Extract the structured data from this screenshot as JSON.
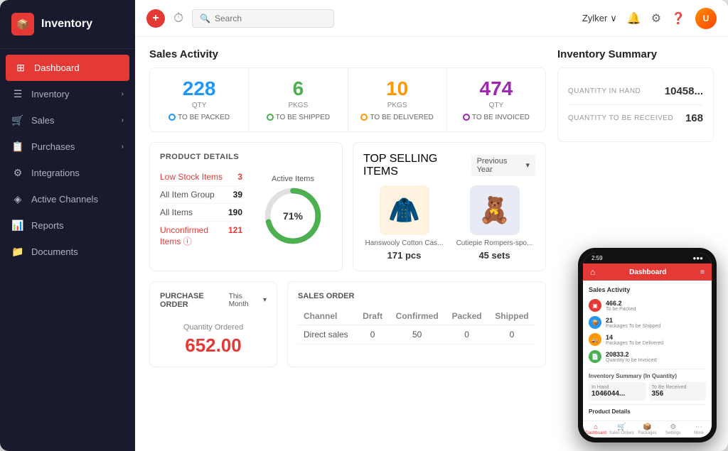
{
  "sidebar": {
    "logo": {
      "icon": "📦",
      "text": "Inventory"
    },
    "items": [
      {
        "id": "dashboard",
        "label": "Dashboard",
        "icon": "⊞",
        "active": true,
        "hasArrow": false
      },
      {
        "id": "inventory",
        "label": "Inventory",
        "icon": "☰",
        "active": false,
        "hasArrow": true
      },
      {
        "id": "sales",
        "label": "Sales",
        "icon": "🛒",
        "active": false,
        "hasArrow": true
      },
      {
        "id": "purchases",
        "label": "Purchases",
        "icon": "📋",
        "active": false,
        "hasArrow": true
      },
      {
        "id": "integrations",
        "label": "Integrations",
        "icon": "⚙",
        "active": false,
        "hasArrow": false
      },
      {
        "id": "active-channels",
        "label": "Active Channels",
        "icon": "◈",
        "active": false,
        "hasArrow": false
      },
      {
        "id": "reports",
        "label": "Reports",
        "icon": "📊",
        "active": false,
        "hasArrow": false
      },
      {
        "id": "documents",
        "label": "Documents",
        "icon": "📁",
        "active": false,
        "hasArrow": false
      }
    ]
  },
  "topbar": {
    "search_placeholder": "Search",
    "org_name": "Zylker",
    "icons": [
      "🔔",
      "⚙",
      "?"
    ]
  },
  "sales_activity": {
    "title": "Sales Activity",
    "cards": [
      {
        "number": "228",
        "unit": "Qty",
        "sub": "TO BE PACKED",
        "color": "#2196f3"
      },
      {
        "number": "6",
        "unit": "Pkgs",
        "sub": "TO BE SHIPPED",
        "color": "#4caf50"
      },
      {
        "number": "10",
        "unit": "Pkgs",
        "sub": "TO BE DELIVERED",
        "color": "#ff9800"
      },
      {
        "number": "474",
        "unit": "Qty",
        "sub": "TO BE INVOICED",
        "color": "#9c27b0"
      }
    ]
  },
  "inventory_summary": {
    "title": "Inventory Summary",
    "rows": [
      {
        "label": "QUANTITY IN HAND",
        "value": "10458..."
      },
      {
        "label": "QUANTITY TO BE RECEIVED",
        "value": "168"
      }
    ]
  },
  "product_details": {
    "title": "PRODUCT DETAILS",
    "stats": [
      {
        "label": "Low Stock Items",
        "value": "3",
        "red": true
      },
      {
        "label": "All Item Group",
        "value": "39",
        "red": false
      },
      {
        "label": "All Items",
        "value": "190",
        "red": false
      },
      {
        "label": "Unconfirmed Items ⓘ",
        "value": "121",
        "red": true
      }
    ],
    "donut": {
      "label": "Active Items",
      "percentage": 71,
      "filled_color": "#4caf50",
      "empty_color": "#e0e0e0"
    }
  },
  "top_selling": {
    "title": "TOP SELLING ITEMS",
    "period": "Previous Year",
    "items": [
      {
        "name": "Hanswooly Cotton Cas...",
        "qty": "171 pcs",
        "emoji": "🧥"
      },
      {
        "name": "Cutiepie Rompers-spo...",
        "qty": "45 sets",
        "emoji": "🧸"
      }
    ]
  },
  "purchase_order": {
    "title": "PURCHASE ORDER",
    "period": "This Month",
    "qty_label": "Quantity Ordered",
    "qty_value": "652.00"
  },
  "sales_order": {
    "title": "SALES ORDER",
    "headers": [
      "Channel",
      "Draft",
      "Confirmed",
      "Packed",
      "Shipped"
    ],
    "rows": [
      {
        "channel": "Direct sales",
        "draft": "0",
        "confirmed": "50",
        "packed": "0",
        "shipped": "0"
      }
    ]
  },
  "phone": {
    "time": "2:59",
    "header": "Dashboard",
    "sales_activity": {
      "title": "Sales Activity",
      "items": [
        {
          "label": "To be Packed",
          "value": "466.2",
          "color": "#e53935"
        },
        {
          "label": "Packages To be Shipped",
          "value": "21",
          "color": "#2196f3"
        },
        {
          "label": "Packages To be Delivered",
          "value": "14",
          "color": "#ff9800"
        },
        {
          "label": "Quantity to be Invoiced",
          "value": "20833.2",
          "color": "#4caf50"
        }
      ]
    },
    "inventory_summary": {
      "title": "Inventory Summary (In Quantity)",
      "in_hand_label": "In Hand",
      "in_hand_value": "1046044...",
      "to_receive_label": "To Be Received",
      "to_receive_value": "356"
    },
    "product_details_label": "Product Details",
    "nav_items": [
      "Dashboard",
      "Sales Orders",
      "Packages",
      "Settings",
      "More"
    ]
  }
}
